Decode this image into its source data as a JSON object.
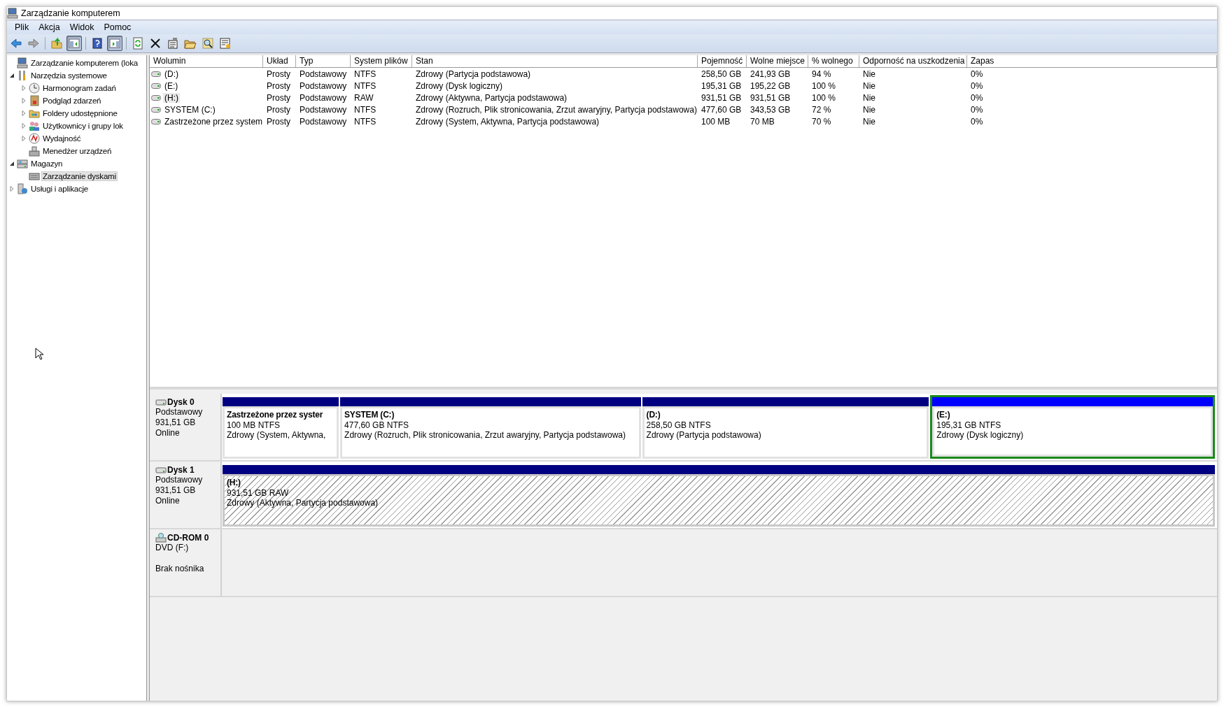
{
  "window": {
    "title": "Zarządzanie komputerem"
  },
  "menu": [
    "Plik",
    "Akcja",
    "Widok",
    "Pomoc"
  ],
  "toolbar": [
    {
      "kind": "back",
      "pressed": false
    },
    {
      "kind": "forward",
      "pressed": false
    },
    {
      "kind": "up",
      "pressed": false
    },
    {
      "kind": "tree",
      "pressed": true
    },
    {
      "kind": "help",
      "pressed": false
    },
    {
      "kind": "pane",
      "pressed": true
    },
    {
      "kind": "refresh",
      "pressed": false
    },
    {
      "kind": "delete",
      "pressed": false
    },
    {
      "kind": "properties",
      "pressed": false
    },
    {
      "kind": "open",
      "pressed": false
    },
    {
      "kind": "search",
      "pressed": false
    },
    {
      "kind": "settings",
      "pressed": false
    }
  ],
  "tree": [
    {
      "label": "Zarządzanie komputerem (loka",
      "selected": false,
      "children": [
        {
          "label": "Narzędzia systemowe",
          "expanded": true,
          "selected": false,
          "children": [
            {
              "label": "Harmonogram zadań",
              "expanded": false,
              "selected": false
            },
            {
              "label": "Podgląd zdarzeń",
              "expanded": false,
              "selected": false
            },
            {
              "label": "Foldery udostępnione",
              "expanded": false,
              "selected": false
            },
            {
              "label": "Użytkownicy i grupy lok",
              "expanded": false,
              "selected": false
            },
            {
              "label": "Wydajność",
              "expanded": false,
              "selected": false
            },
            {
              "label": "Menedżer urządzeń",
              "selected": false
            }
          ]
        },
        {
          "label": "Magazyn",
          "expanded": true,
          "selected": false,
          "children": [
            {
              "label": "Zarządzanie dyskami",
              "selected": true
            }
          ]
        },
        {
          "label": "Usługi i aplikacje",
          "expanded": false,
          "selected": false
        }
      ]
    }
  ],
  "table": {
    "columns": [
      "Wolumin",
      "Układ",
      "Typ",
      "System plików",
      "Stan",
      "Pojemność",
      "Wolne miejsce",
      "% wolnego",
      "Odporność na uszkodzenia",
      "Zapas"
    ],
    "rows": [
      {
        "selected": false,
        "cells": [
          "(D:)",
          "Prosty",
          "Podstawowy",
          "NTFS",
          "Zdrowy (Partycja podstawowa)",
          "258,50 GB",
          "241,93 GB",
          "94 %",
          "Nie",
          "0%"
        ]
      },
      {
        "selected": false,
        "cells": [
          "(E:)",
          "Prosty",
          "Podstawowy",
          "NTFS",
          "Zdrowy (Dysk logiczny)",
          "195,31 GB",
          "195,22 GB",
          "100 %",
          "Nie",
          "0%"
        ]
      },
      {
        "selected": true,
        "cells": [
          "(H:)",
          "Prosty",
          "Podstawowy",
          "RAW",
          "Zdrowy (Aktywna, Partycja podstawowa)",
          "931,51 GB",
          "931,51 GB",
          "100 %",
          "Nie",
          "0%"
        ]
      },
      {
        "selected": false,
        "cells": [
          "SYSTEM (C:)",
          "Prosty",
          "Podstawowy",
          "NTFS",
          "Zdrowy (Rozruch, Plik stronicowania, Zrzut awaryjny, Partycja podstawowa)",
          "477,60 GB",
          "343,53 GB",
          "72 %",
          "Nie",
          "0%"
        ]
      },
      {
        "selected": false,
        "cells": [
          "Zastrzeżone przez system",
          "Prosty",
          "Podstawowy",
          "NTFS",
          "Zdrowy (System, Aktywna, Partycja podstawowa)",
          "100 MB",
          "70 MB",
          "70 %",
          "Nie",
          "0%"
        ]
      }
    ]
  },
  "disks": [
    {
      "kind": "disk",
      "name": "Dysk 0",
      "lines": [
        "Podstawowy",
        "931,51 GB",
        "Online"
      ],
      "partitions": [
        {
          "kind": "primary",
          "selected": false,
          "name": "Zastrzeżone przez syster",
          "size": "100 MB NTFS",
          "status": "Zdrowy (System, Aktywna,"
        },
        {
          "kind": "primary",
          "selected": false,
          "name": "SYSTEM  (C:)",
          "size": "477,60 GB NTFS",
          "status": "Zdrowy (Rozruch, Plik stronicowania, Zrzut awaryjny, Partycja podstawowa)"
        },
        {
          "kind": "primary",
          "selected": false,
          "name": "(D:)",
          "size": "258,50 GB NTFS",
          "status": "Zdrowy (Partycja podstawowa)"
        },
        {
          "kind": "logical",
          "selected": false,
          "name": "(E:)",
          "size": "195,31 GB NTFS",
          "status": "Zdrowy (Dysk logiczny)"
        }
      ]
    },
    {
      "kind": "disk",
      "name": "Dysk 1",
      "lines": [
        "Podstawowy",
        "931,51 GB",
        "Online"
      ],
      "partitions": [
        {
          "kind": "primary",
          "selected": true,
          "name": "(H:)",
          "size": "931,51 GB RAW",
          "status": "Zdrowy (Aktywna, Partycja podstawowa)"
        }
      ]
    },
    {
      "kind": "cdrom",
      "name": "CD-ROM 0",
      "lines": [
        "DVD (F:)"
      ],
      "media": "Brak nośnika"
    }
  ]
}
